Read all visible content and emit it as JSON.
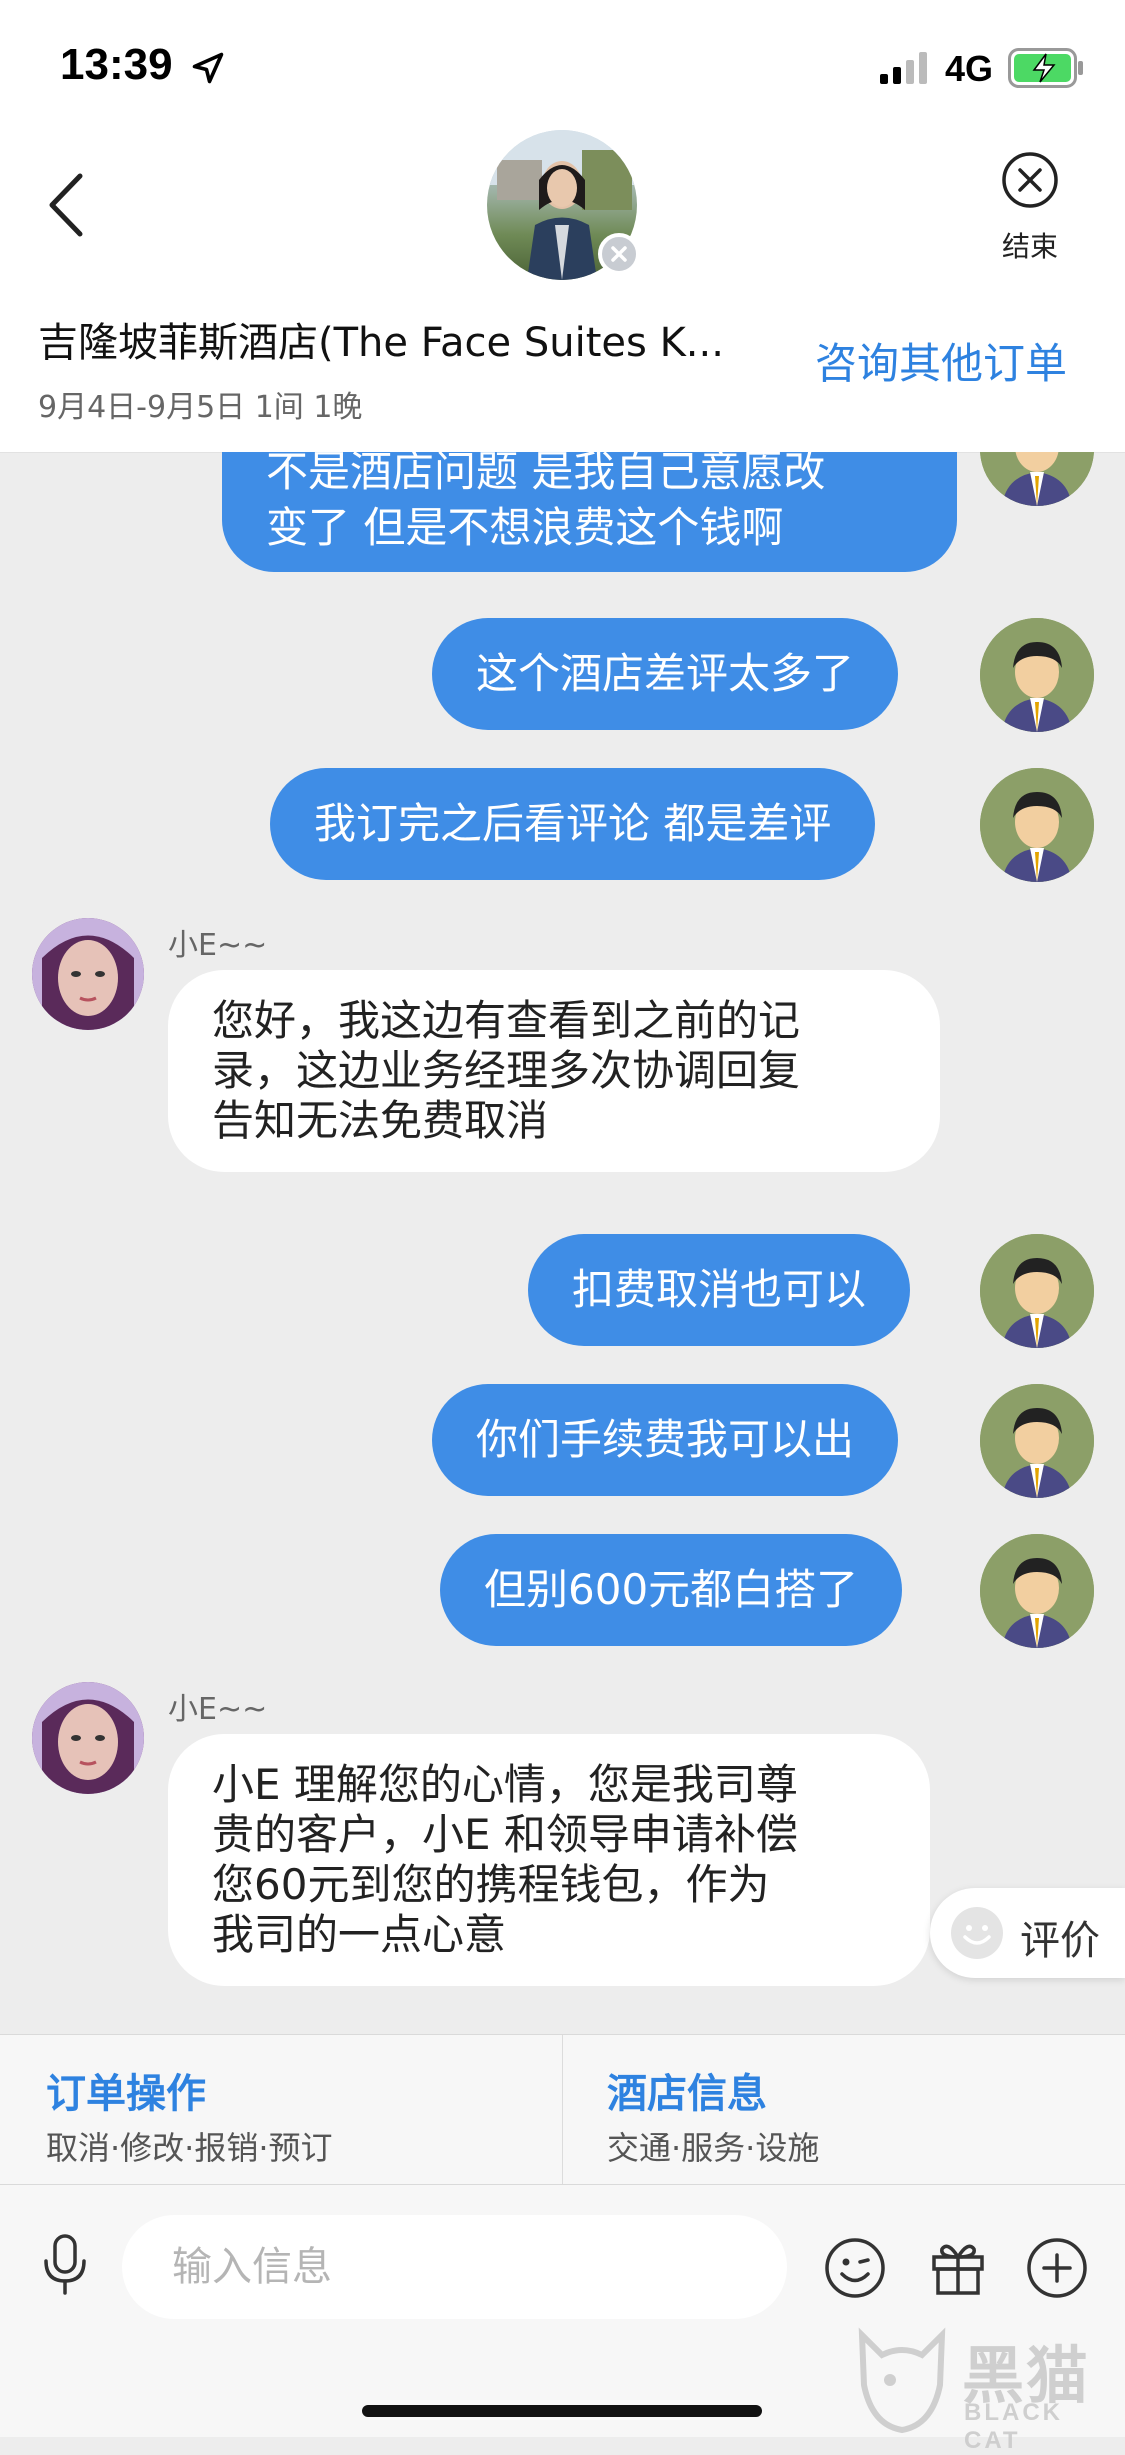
{
  "status_bar": {
    "time": "13:39",
    "network": "4G"
  },
  "header": {
    "hotel_title": "吉隆坡菲斯酒店(The Face Suites K...",
    "stay_dates": "9月4日-9月5日 1间 1晚",
    "other_orders_label": "咨询其他订单",
    "end_label": "结束"
  },
  "messages": [
    {
      "sender": "user",
      "text_lines": [
        "不是酒店问题 是我自己意愿改",
        "变了 但是不想浪费这个钱啊"
      ]
    },
    {
      "sender": "user",
      "text": "这个酒店差评太多了"
    },
    {
      "sender": "user",
      "text": "我订完之后看评论 都是差评"
    },
    {
      "sender": "agent",
      "name": "小E~~",
      "text_lines": [
        "您好，我这边有查看到之前的记",
        "录，这边业务经理多次协调回复",
        "告知无法免费取消"
      ]
    },
    {
      "sender": "user",
      "text": "扣费取消也可以"
    },
    {
      "sender": "user",
      "text": "你们手续费我可以出"
    },
    {
      "sender": "user",
      "text": "但别600元都白搭了"
    },
    {
      "sender": "agent",
      "name": "小E~~",
      "text_lines": [
        "小E 理解您的心情，您是我司尊",
        "贵的客户，小E 和领导申请补偿",
        "您60元到您的携程钱包，作为",
        "我司的一点心意"
      ]
    }
  ],
  "rate_label": "评价",
  "quick_panel": {
    "order_ops": {
      "title": "订单操作",
      "sub": "取消·修改·报销·预订"
    },
    "hotel_info": {
      "title": "酒店信息",
      "sub": "交通·服务·设施"
    }
  },
  "input": {
    "placeholder": "输入信息"
  },
  "watermark": {
    "cn": "黑猫",
    "en": "BLACK CAT"
  },
  "colors": {
    "accent": "#2e82e0",
    "user_bubble": "#3f8de6",
    "background": "#ededed"
  }
}
